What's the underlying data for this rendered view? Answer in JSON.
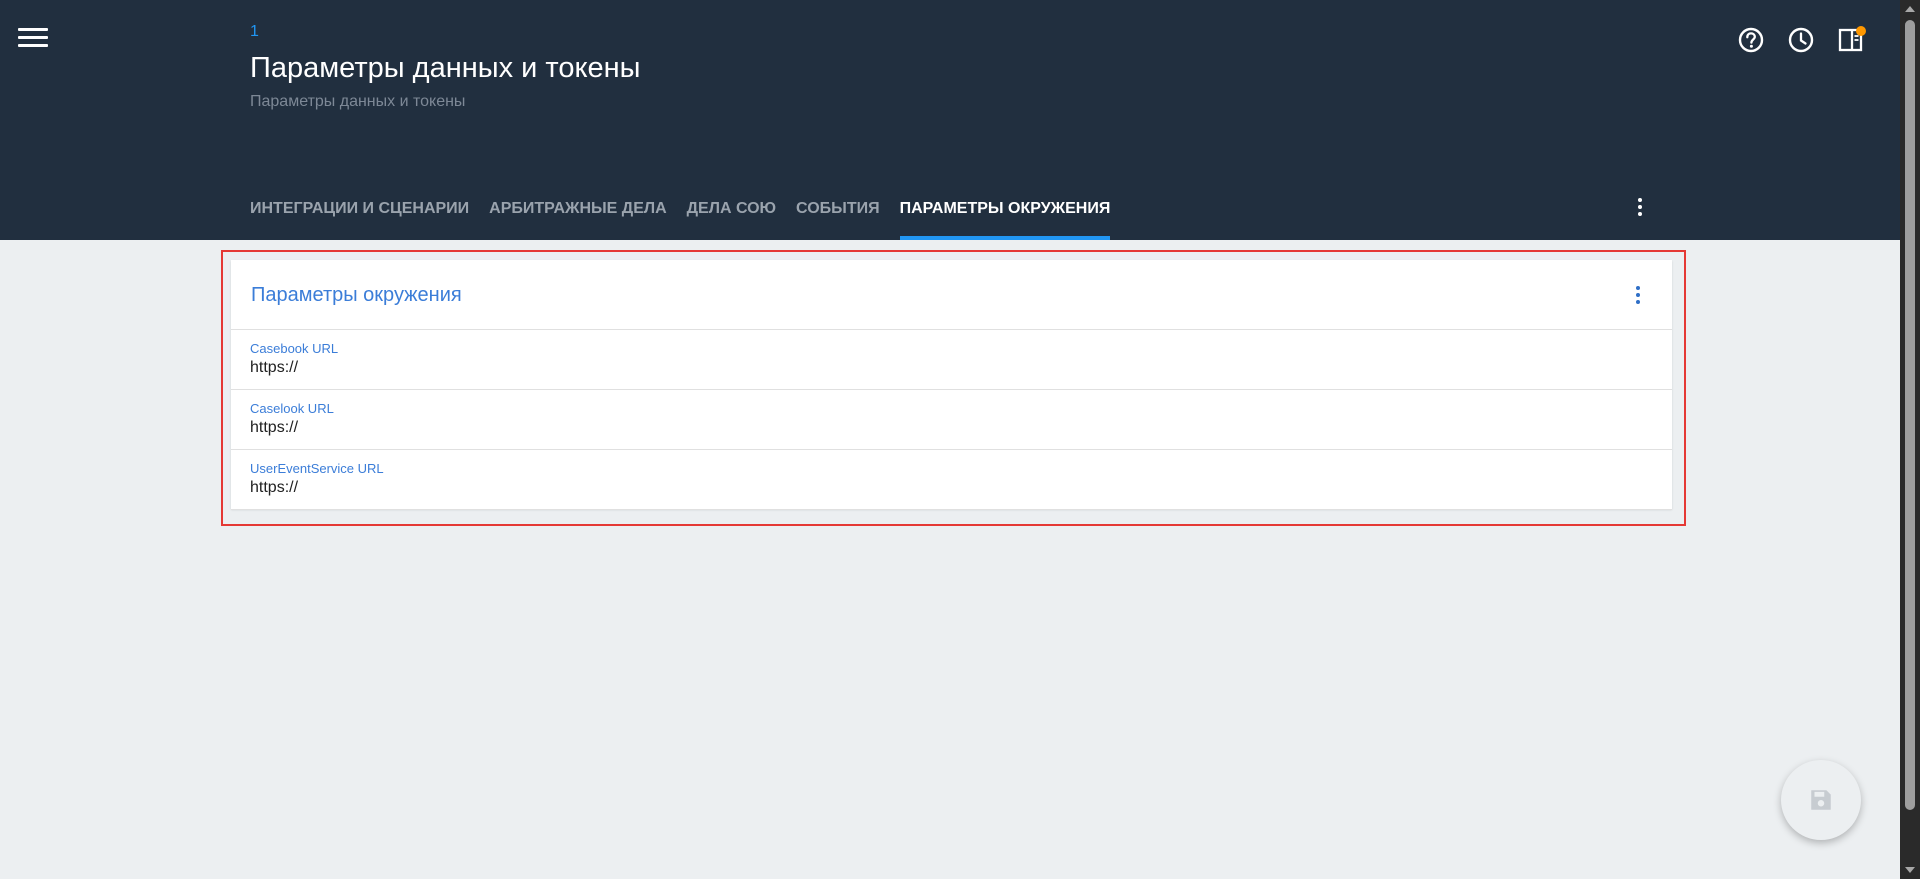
{
  "header": {
    "breadcrumb": "1",
    "title": "Параметры данных и токены",
    "subtitle": "Параметры данных и токены",
    "icons": [
      "help-icon",
      "history-icon",
      "panel-icon"
    ]
  },
  "tabs": [
    {
      "label": "ИНТЕГРАЦИИ И СЦЕНАРИИ",
      "active": false
    },
    {
      "label": "АРБИТРАЖНЫЕ ДЕЛА",
      "active": false
    },
    {
      "label": "ДЕЛА СОЮ",
      "active": false
    },
    {
      "label": "СОБЫТИЯ",
      "active": false
    },
    {
      "label": "ПАРАМЕТРЫ ОКРУЖЕНИЯ",
      "active": true
    }
  ],
  "card": {
    "title": "Параметры окружения",
    "fields": [
      {
        "label": "Casebook URL",
        "value": "https://"
      },
      {
        "label": "Caselook URL",
        "value": "https://"
      },
      {
        "label": "UserEventService URL",
        "value": "https://"
      }
    ]
  },
  "fab": {
    "icon": "save-icon"
  },
  "colors": {
    "header_bg": "#212f3f",
    "accent": "#2196f3",
    "link_blue": "#3b7dd8",
    "notification": "#ff9800",
    "highlight_border": "#e53935",
    "page_bg": "#eceff1"
  }
}
